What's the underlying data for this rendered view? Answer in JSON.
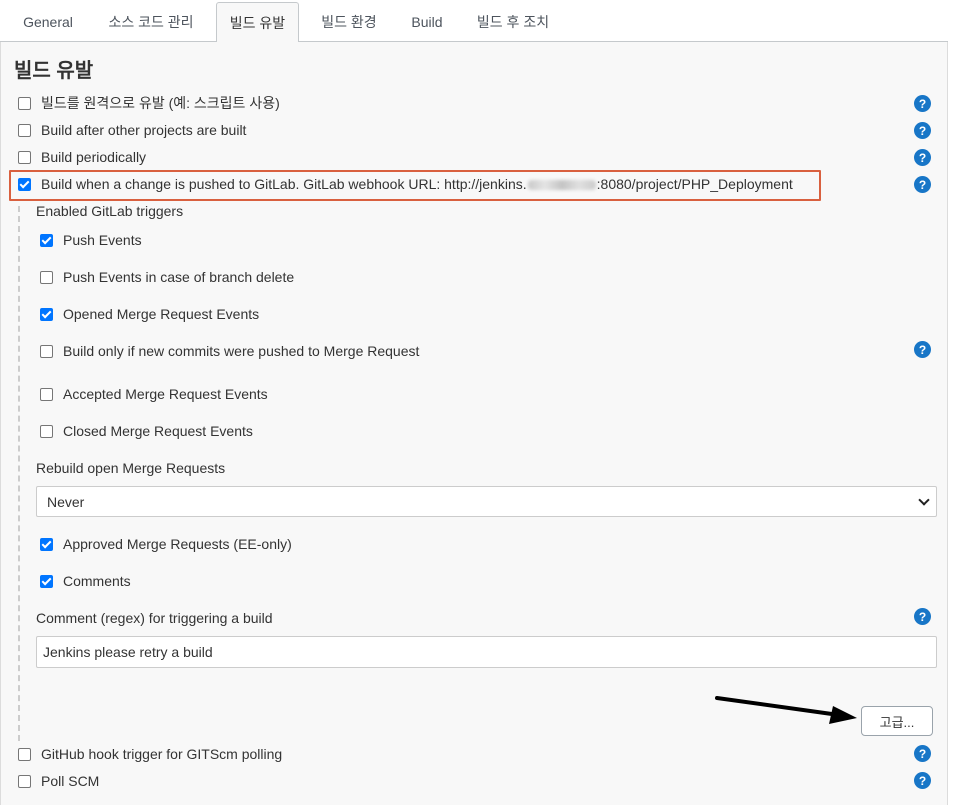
{
  "tabs": [
    {
      "label": "General"
    },
    {
      "label": "소스 코드 관리"
    },
    {
      "label": "빌드 유발"
    },
    {
      "label": "빌드 환경"
    },
    {
      "label": "Build"
    },
    {
      "label": "빌드 후 조치"
    }
  ],
  "section": {
    "title": "빌드 유발",
    "triggers": [
      {
        "label": "빌드를 원격으로 유발 (예: 스크립트 사용)",
        "checked": false
      },
      {
        "label": "Build after other projects are built",
        "checked": false
      },
      {
        "label": "Build periodically",
        "checked": false
      }
    ],
    "gitlab_trigger": {
      "label_prefix": "Build when a change is pushed to GitLab. GitLab webhook URL: http://jenkins.",
      "label_suffix": ":8080/project/PHP_Deployment",
      "checked": true
    },
    "gitlab": {
      "enabled_label": "Enabled GitLab triggers",
      "events": [
        {
          "label": "Push Events",
          "checked": true
        },
        {
          "label": "Push Events in case of branch delete",
          "checked": false
        },
        {
          "label": "Opened Merge Request Events",
          "checked": true
        },
        {
          "label": "Build only if new commits were pushed to Merge Request",
          "checked": false
        },
        {
          "label": "Accepted Merge Request Events",
          "checked": false
        },
        {
          "label": "Closed Merge Request Events",
          "checked": false
        }
      ],
      "rebuild_label": "Rebuild open Merge Requests",
      "rebuild_value": "Never",
      "extra": [
        {
          "label": "Approved Merge Requests (EE-only)",
          "checked": true
        },
        {
          "label": "Comments",
          "checked": true
        }
      ],
      "comment_label": "Comment (regex) for triggering a build",
      "comment_value": "Jenkins please retry a build",
      "advanced_label": "고급..."
    },
    "bottom": [
      {
        "label": "GitHub hook trigger for GITScm polling",
        "checked": false
      },
      {
        "label": "Poll SCM",
        "checked": false
      }
    ],
    "help_glyph": "?"
  },
  "colors": {
    "accent": "#0075ff",
    "help": "#1876c7",
    "highlight": "#d9603f"
  }
}
